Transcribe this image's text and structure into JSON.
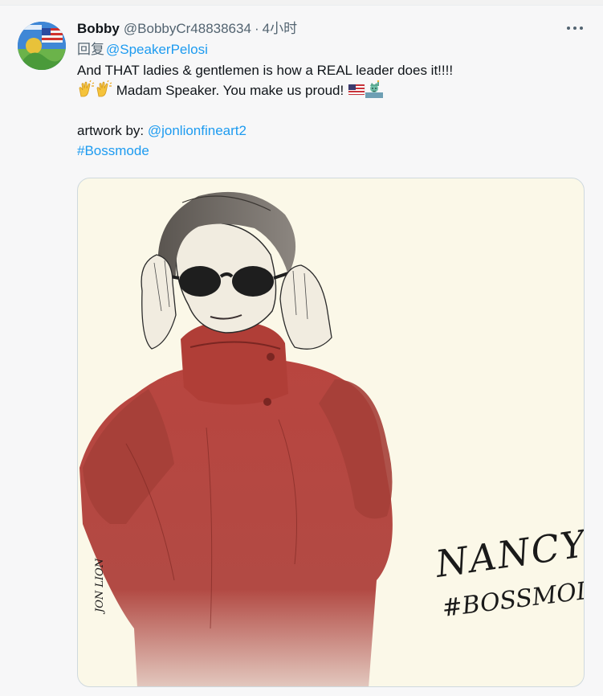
{
  "tweet": {
    "author_name": "Bobby",
    "author_handle": "@BobbyCr48838634",
    "separator": "·",
    "timestamp": "4小时",
    "reply_prefix": "回复",
    "reply_to": "@SpeakerPelosi",
    "line1": "And THAT ladies & gentlemen is how a REAL leader does it!!!!",
    "line2_text": " Madam Speaker. You make us proud! ",
    "artwork_prefix": "artwork by: ",
    "artwork_mention": "@jonlionfineart2",
    "hashtag": "#Bossmode",
    "emojis": [
      "clapping-hands",
      "clapping-hands",
      "us-flag",
      "statue-of-liberty"
    ]
  },
  "media": {
    "signature_name": "NANCY",
    "signature_tag": "#BOSSMODE",
    "artist_signature": "JON LION"
  },
  "colors": {
    "link": "#1d9bf0",
    "text": "#0f1419",
    "secondary": "#536471",
    "coat_red": "#b8453f",
    "paper": "#fbf8e8"
  }
}
